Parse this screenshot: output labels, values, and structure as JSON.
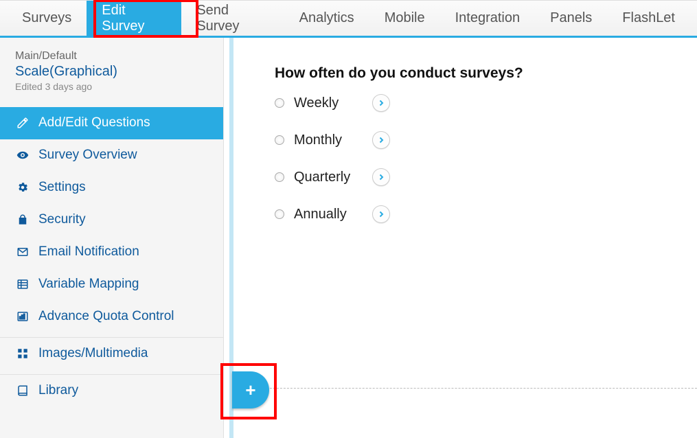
{
  "tabs": {
    "surveys": "Surveys",
    "edit_survey": "Edit Survey",
    "send_survey": "Send Survey",
    "analytics": "Analytics",
    "mobile": "Mobile",
    "integration": "Integration",
    "panels": "Panels",
    "flashlet": "FlashLet"
  },
  "survey": {
    "breadcrumb": "Main/Default",
    "title": "Scale(Graphical)",
    "edited": "Edited 3 days ago"
  },
  "sidebar": {
    "add_edit": "Add/Edit Questions",
    "overview": "Survey Overview",
    "settings": "Settings",
    "security": "Security",
    "email": "Email Notification",
    "variable_mapping": "Variable Mapping",
    "advance_quota": "Advance Quota Control",
    "images": "Images/Multimedia",
    "library": "Library"
  },
  "question": {
    "text": "How often do you conduct surveys?",
    "options": {
      "weekly": "Weekly",
      "monthly": "Monthly",
      "quarterly": "Quarterly",
      "annually": "Annually"
    }
  },
  "add_button": "+"
}
